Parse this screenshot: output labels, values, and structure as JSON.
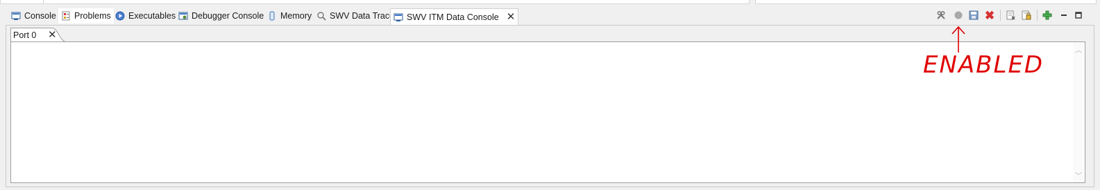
{
  "tabs": [
    {
      "label": "Console",
      "icon": "console-icon"
    },
    {
      "label": "Problems",
      "icon": "problems-icon"
    },
    {
      "label": "Executables",
      "icon": "executables-icon"
    },
    {
      "label": "Debugger Console",
      "icon": "debugger-console-icon"
    },
    {
      "label": "Memory",
      "icon": "memory-icon"
    },
    {
      "label": "SWV Data Trace",
      "icon": "search-icon"
    },
    {
      "label": "SWV ITM Data Console",
      "icon": "console-icon",
      "active": true
    }
  ],
  "subtab": {
    "label": "Port 0"
  },
  "toolbar": [
    "settings-icon",
    "record-icon",
    "save-icon",
    "remove-icon",
    "clear-icon",
    "lock-icon",
    "add-icon",
    "minimize-icon",
    "maximize-icon"
  ],
  "annotation": {
    "text": "ENABLED",
    "color": "#e00000"
  }
}
